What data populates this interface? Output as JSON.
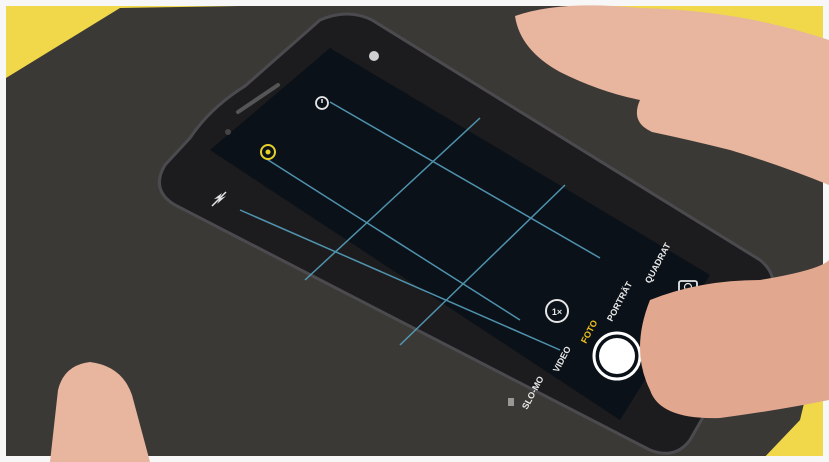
{
  "camera": {
    "modes": [
      {
        "label": "SLO-MO"
      },
      {
        "label": "VIDEO"
      },
      {
        "label": "FOTO"
      },
      {
        "label": "PORTRÄT"
      },
      {
        "label": "QUADRAT"
      }
    ],
    "zoom_label": "1×"
  },
  "colors": {
    "surface": "#3a3936",
    "yellow": "#f0d84a",
    "phone_body": "#1c1c1e",
    "screen": "#0b1118",
    "grid": "#5aa9c8",
    "active_mode": "#f2c21b",
    "mode_text": "#e8e8e8",
    "skin": "#e8b59e"
  },
  "icons": [
    "flash-off-icon",
    "live-photo-icon",
    "timer-icon",
    "switch-camera-icon",
    "shutter-button"
  ]
}
